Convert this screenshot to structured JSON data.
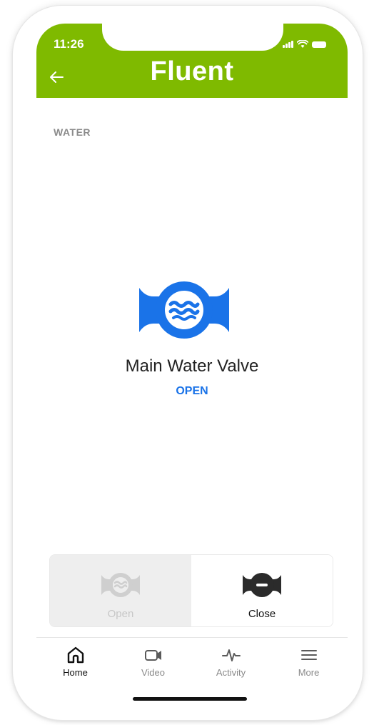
{
  "status_bar": {
    "time": "11:26"
  },
  "header": {
    "brand": "Fluent"
  },
  "section": {
    "label": "WATER"
  },
  "device": {
    "name": "Main Water Valve",
    "status": "OPEN"
  },
  "controls": {
    "open_label": "Open",
    "close_label": "Close"
  },
  "tabs": [
    {
      "label": "Home",
      "icon": "home-icon",
      "active": true
    },
    {
      "label": "Video",
      "icon": "video-camera-icon",
      "active": false
    },
    {
      "label": "Activity",
      "icon": "activity-pulse-icon",
      "active": false
    },
    {
      "label": "More",
      "icon": "menu-icon",
      "active": false
    }
  ],
  "colors": {
    "header_bg": "#7fba00",
    "status_open": "#1a73e8",
    "valve_icon": "#1a73e8",
    "close_icon": "#2b2b2b"
  }
}
